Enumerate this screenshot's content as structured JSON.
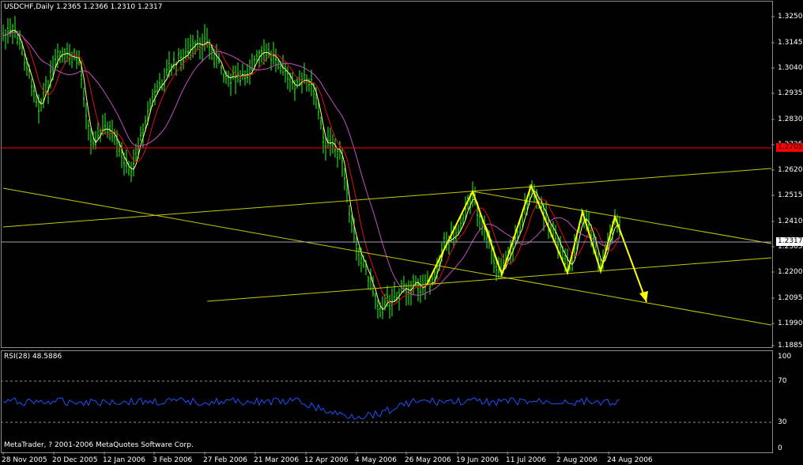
{
  "window": {
    "header": "USDCHF,Daily  1.2365 1.2366 1.2310 1.2317",
    "copyright": "MetaTrader, ? 2001-2006 MetaQuotes Software Corp."
  },
  "colors": {
    "background": "#000000",
    "candles": "#22ff22",
    "pattern": "#ffff00",
    "channel": "#c8c800",
    "hline": "#ff0000",
    "ma_fast": "#ffff80",
    "ma_mid": "#e01010",
    "ma_slow": "#c050c0",
    "rsi": "#2050ff",
    "grid": "#8c8c8c"
  },
  "price_axis": {
    "labels": [
      "1.3250",
      "1.3145",
      "1.3040",
      "1.2935",
      "1.2830",
      "1.2725",
      "1.2620",
      "1.2515",
      "1.2410",
      "1.2305",
      "1.2200",
      "1.2095",
      "1.1990",
      "1.1885"
    ],
    "current_price": "1.2317",
    "resistance_price": "1.2705"
  },
  "rsi": {
    "header": "RSI(28) 48.5886",
    "levels": [
      "100",
      "70",
      "30",
      "0"
    ]
  },
  "date_axis": [
    "28 Nov 2005",
    "20 Dec 2005",
    "12 Jan 2006",
    "3 Feb 2006",
    "27 Feb 2006",
    "21 Mar 2006",
    "12 Apr 2006",
    "4 May 2006",
    "26 May 2006",
    "19 Jun 2006",
    "11 Jul 2006",
    "2 Aug 2006",
    "24 Aug 2006"
  ]
}
